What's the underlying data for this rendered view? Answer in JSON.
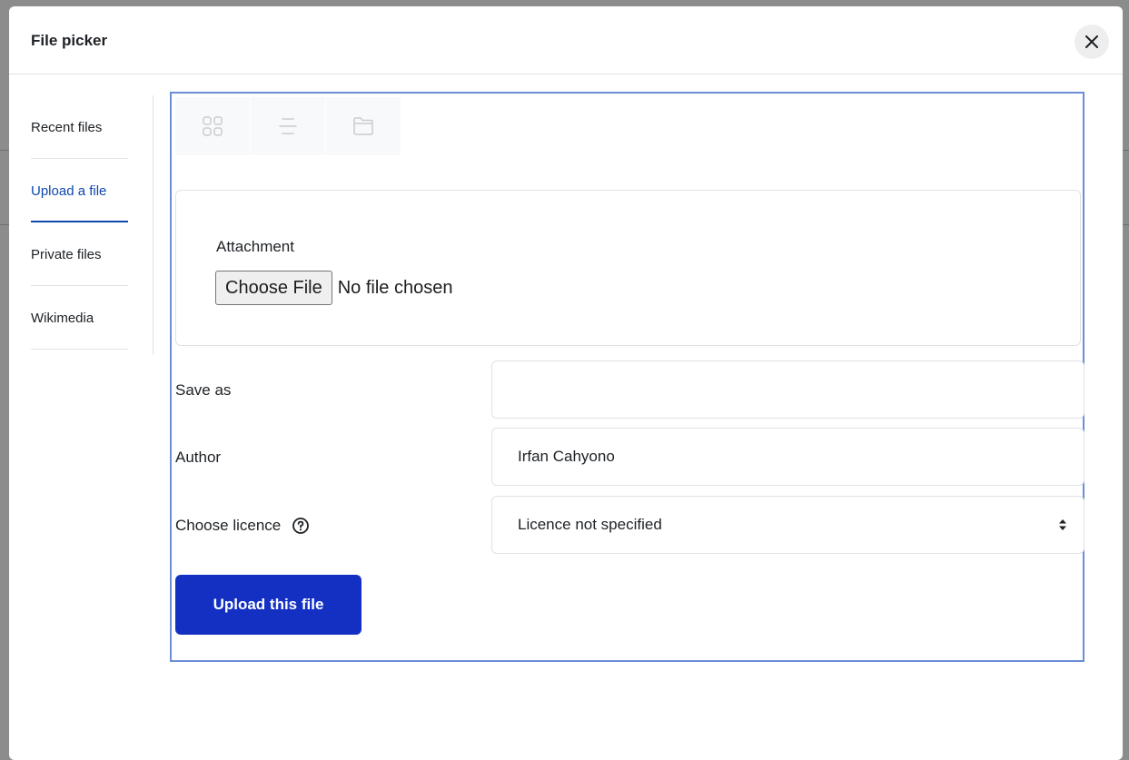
{
  "modal": {
    "title": "File picker"
  },
  "sidebar": {
    "items": [
      {
        "label": "Recent files"
      },
      {
        "label": "Upload a file"
      },
      {
        "label": "Private files"
      },
      {
        "label": "Wikimedia"
      }
    ],
    "active": "Upload a file"
  },
  "viewbar": {
    "icons": [
      "grid-view-icon",
      "list-view-icon",
      "folder-view-icon"
    ]
  },
  "attachment": {
    "label": "Attachment",
    "button_label": "Choose File",
    "status": "No file chosen"
  },
  "form": {
    "save_as": {
      "label": "Save as",
      "value": ""
    },
    "author": {
      "label": "Author",
      "value": "Irfan Cahyono"
    },
    "licence": {
      "label": "Choose licence",
      "selected": "Licence not specified",
      "help_icon": "question-circle-icon"
    }
  },
  "upload_button": {
    "label": "Upload this file"
  },
  "colors": {
    "accent": "#0f47ad",
    "primary_button": "#1330c3",
    "panel_border": "#6b8fd4",
    "overlay": "#8c8c8c"
  }
}
